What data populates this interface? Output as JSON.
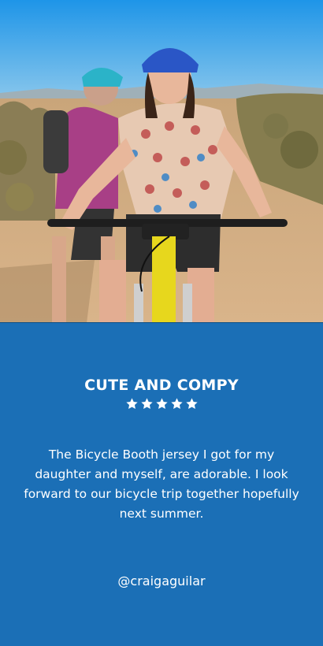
{
  "testimonial": {
    "title": "CUTE AND COMPY",
    "rating": 5,
    "rating_max": 5,
    "review_text": "The Bicycle Booth jersey I got for my daughter and myself, are adorable. I look forward to our bicycle trip together hopefully next summer.",
    "author_handle": "@craigaguilar"
  },
  "colors": {
    "background": "#1b6fb6",
    "text": "#ffffff",
    "star": "#ffffff"
  },
  "photo": {
    "subject": "girl and woman riding mountain bikes on desert dirt trail"
  }
}
